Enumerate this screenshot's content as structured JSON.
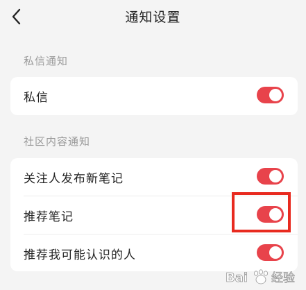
{
  "header": {
    "title": "通知设置",
    "back_icon": "chevron-left-icon"
  },
  "sections": [
    {
      "label": "私信通知",
      "items": [
        {
          "label": "私信",
          "enabled": true
        }
      ]
    },
    {
      "label": "社区内容通知",
      "items": [
        {
          "label": "关注人发布新笔记",
          "enabled": true
        },
        {
          "label": "推荐笔记",
          "enabled": true
        },
        {
          "label": "推荐我可能认识的人",
          "enabled": true
        }
      ]
    }
  ],
  "colors": {
    "toggle_on": "#e8434b",
    "highlight": "#e82a1f",
    "background": "#f4f4f4"
  },
  "watermark": {
    "text": "Bai 经验"
  }
}
